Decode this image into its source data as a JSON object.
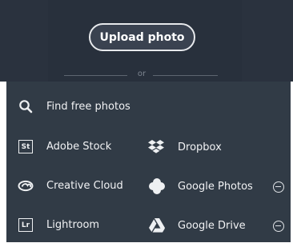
{
  "upload": {
    "label": "Upload photo"
  },
  "divider": {
    "text": "or"
  },
  "sources": {
    "find_free_photos": "Find free photos",
    "adobe_stock": {
      "label": "Adobe Stock",
      "badge": "St"
    },
    "creative_cloud": "Creative Cloud",
    "lightroom": {
      "label": "Lightroom",
      "badge": "Lr"
    },
    "dropbox": "Dropbox",
    "google_photos": "Google Photos",
    "google_drive": "Google Drive"
  }
}
